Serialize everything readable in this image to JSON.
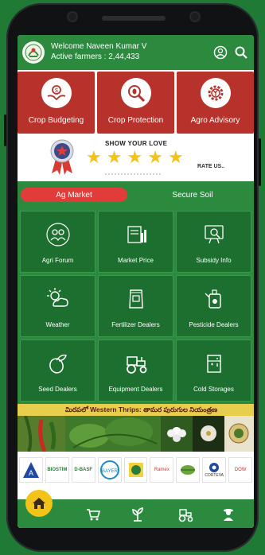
{
  "header": {
    "welcome_text": "Welcome Naveen Kumar V",
    "active_farmers_text": "Active farmers : 2,44,433"
  },
  "top_tiles": [
    {
      "label": "Crop Budgeting",
      "icon": "money-hands-icon"
    },
    {
      "label": "Crop Protection",
      "icon": "magnifier-bug-icon"
    },
    {
      "label": "Agro Advisory",
      "icon": "gear-plant-icon"
    }
  ],
  "rating": {
    "heading": "SHOW YOUR LOVE",
    "stars": 5,
    "rate_label": "RATE US.."
  },
  "tabs": [
    {
      "label": "Ag Market",
      "active": true
    },
    {
      "label": "Secure Soil",
      "active": false
    }
  ],
  "grid": [
    {
      "label": "Agri Forum",
      "icon": "people-chat-icon"
    },
    {
      "label": "Market Price",
      "icon": "price-chart-icon"
    },
    {
      "label": "Subsidy Info",
      "icon": "subsidy-monitor-icon"
    },
    {
      "label": "Weather",
      "icon": "weather-sun-cloud-icon"
    },
    {
      "label": "Fertilizer Dealers",
      "icon": "fertilizer-bag-icon"
    },
    {
      "label": "Pesticide Dealers",
      "icon": "pesticide-sprayer-icon"
    },
    {
      "label": "Seed Dealers",
      "icon": "seed-icon"
    },
    {
      "label": "Equipment Dealers",
      "icon": "tractor-icon"
    },
    {
      "label": "Cold Storages",
      "icon": "cold-storage-icon"
    }
  ],
  "banner": {
    "text": "మిరపలో Western Thrips: తామర పురుగుల నియంత్రణ"
  },
  "brands": [
    "A",
    "BIOSTIM",
    "D-BASF",
    "BAYER",
    "",
    "Ramex",
    "",
    "CORTEVA",
    "DOW"
  ],
  "colors": {
    "header_green": "#2b8a3e",
    "tile_red": "#b8322c",
    "tab_active_red": "#e23c3a",
    "grid_green": "#1d6f2f",
    "star_yellow": "#f2c318",
    "home_yellow": "#f2c318"
  },
  "bottom_nav": [
    "home-icon",
    "cart-icon",
    "plant-icon",
    "tractor-icon",
    "farmer-icon"
  ]
}
